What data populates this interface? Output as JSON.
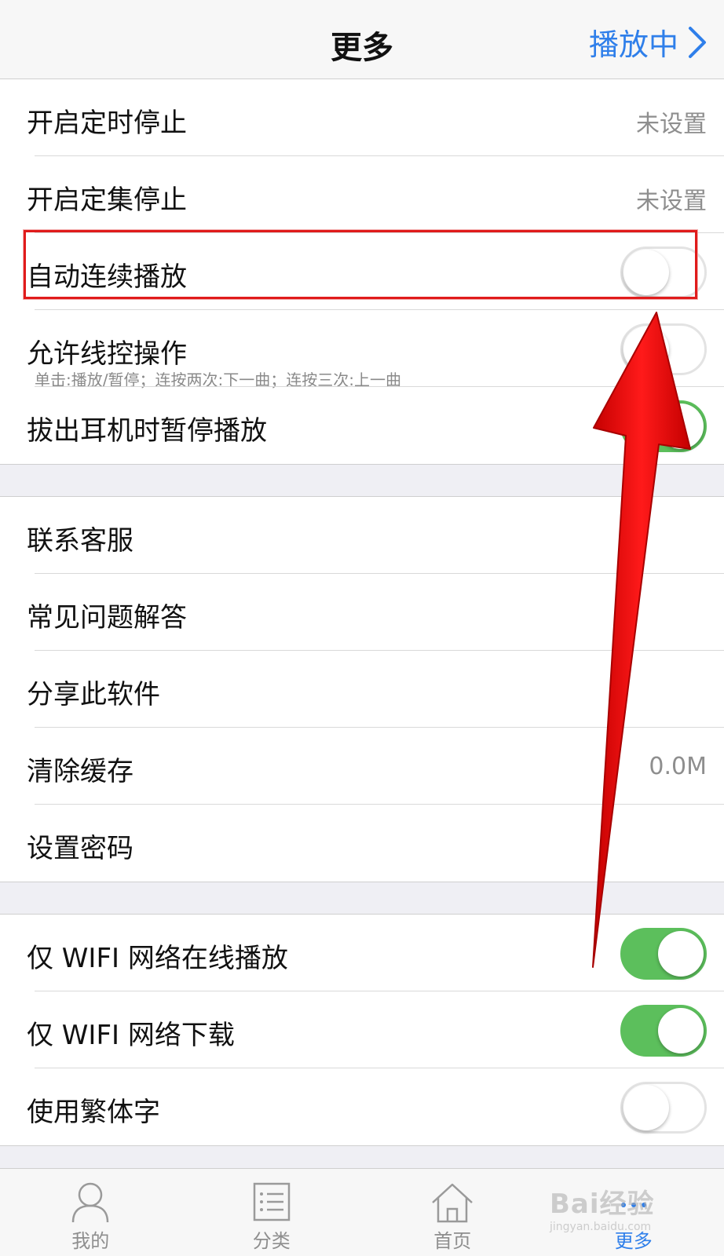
{
  "nav": {
    "title": "更多",
    "now_playing": "播放中"
  },
  "timer": {
    "timer_stop": {
      "label": "开启定时停止",
      "value": "未设置"
    },
    "episode_stop": {
      "label": "开启定集停止",
      "value": "未设置"
    }
  },
  "playback": {
    "autoplay": {
      "label": "自动连续播放",
      "on": false
    },
    "remote": {
      "label": "允许线控操作",
      "hint": "单击:播放/暂停；连按两次:下一曲；连按三次:上一曲",
      "on": false
    },
    "headphone_pause": {
      "label": "拔出耳机时暂停播放",
      "on": true
    }
  },
  "support": {
    "contact": "联系客服",
    "faq": "常见问题解答",
    "share": "分享此软件",
    "clear_cache": {
      "label": "清除缓存",
      "value": "0.0M"
    },
    "password": "设置密码"
  },
  "network": {
    "wifi_stream": {
      "label": "仅 WIFI 网络在线播放",
      "on": true
    },
    "wifi_download": {
      "label": "仅 WIFI 网络下载",
      "on": true
    },
    "traditional": {
      "label": "使用繁体字",
      "on": false
    }
  },
  "tabs": [
    {
      "label": "我的",
      "icon": "user-icon"
    },
    {
      "label": "分类",
      "icon": "list-icon"
    },
    {
      "label": "首页",
      "icon": "home-icon"
    },
    {
      "label": "更多",
      "icon": "more-icon",
      "active": true
    }
  ],
  "colors": {
    "accent": "#2f7fea",
    "toggle_on": "#5cbf5c",
    "highlight": "#e01b1b"
  },
  "watermark": {
    "text": "Bai经验",
    "sub": "jingyan.baidu.com"
  }
}
